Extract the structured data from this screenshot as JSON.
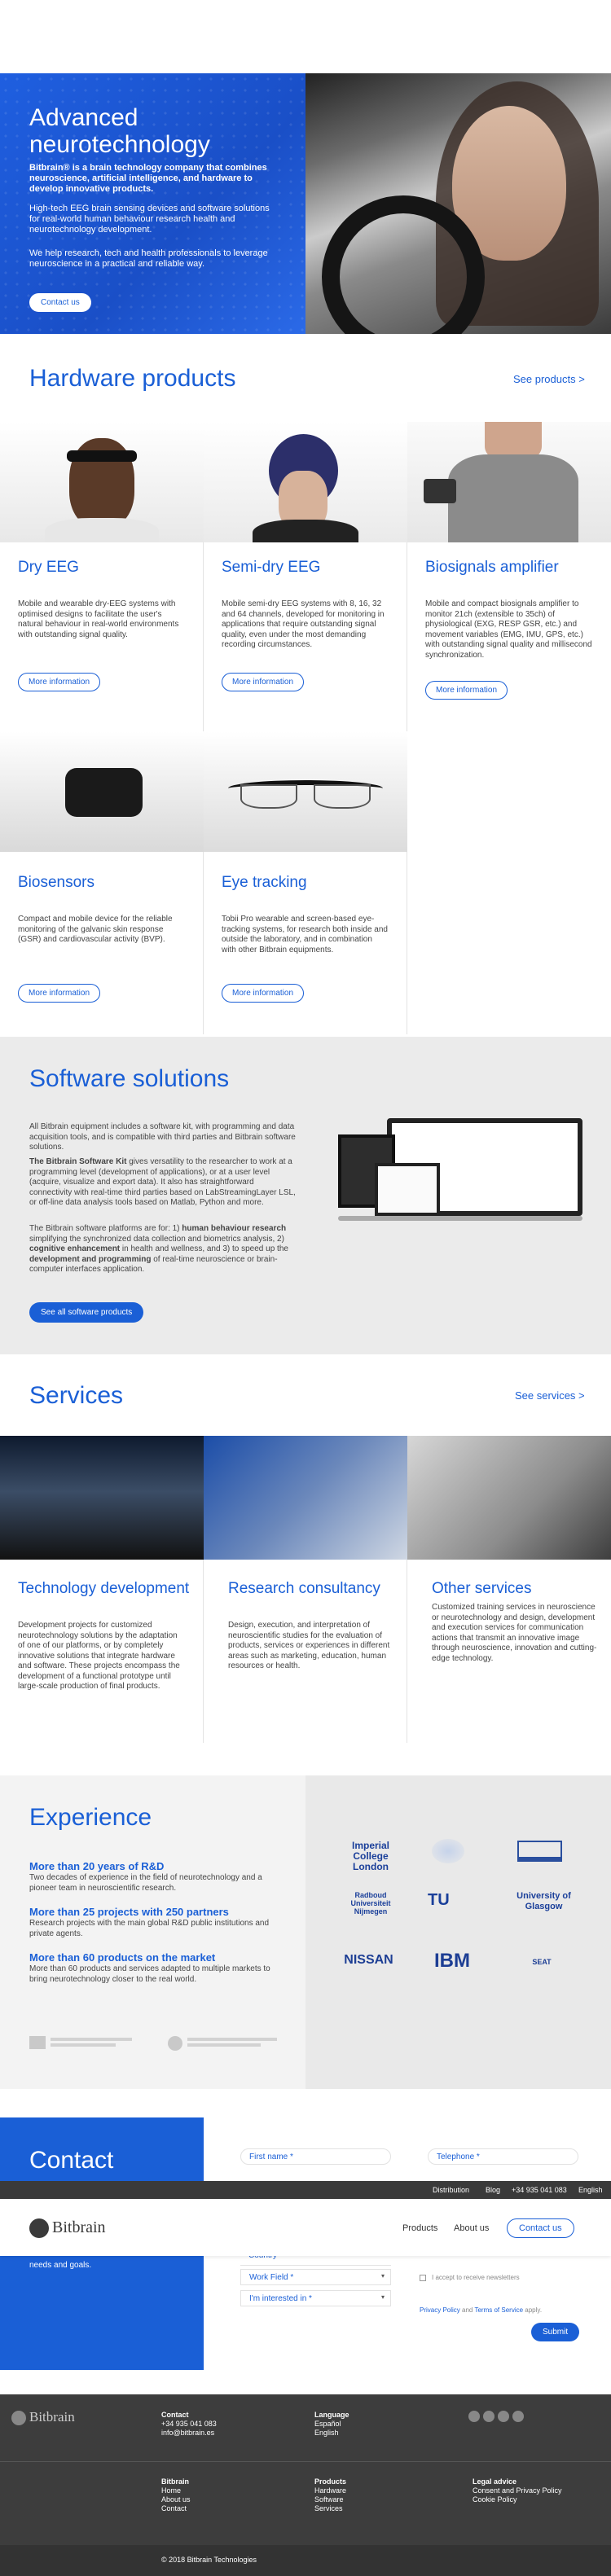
{
  "hero": {
    "title_line1": "Advanced",
    "title_line2": "neurotechnology",
    "tagline": "Bitbrain® is a brain technology company that combines neuroscience, artificial intelligence, and hardware to develop innovative products.",
    "para1": "High-tech EEG brain sensing devices and software solutions for real-world human behaviour research health and neurotechnology development.",
    "para2": "We help research, tech and health professionals to leverage neuroscience in a practical and reliable way.",
    "cta": "Contact us"
  },
  "hardware": {
    "title": "Hardware products",
    "link": "See products >",
    "products": [
      {
        "title": "Dry EEG",
        "desc": "Mobile and wearable dry-EEG systems with optimised designs to facilitate the user's natural behaviour in real-world environments with outstanding signal quality.",
        "button": "More information"
      },
      {
        "title": "Semi-dry EEG",
        "desc": "Mobile semi-dry EEG systems with 8, 16, 32 and 64 channels, developed for monitoring in applications that require outstanding signal quality, even under the most demanding recording circumstances.",
        "button": "More information"
      },
      {
        "title": "Biosignals amplifier",
        "desc": "Mobile and compact biosignals amplifier to monitor 21ch (extensible to 35ch) of physiological (EXG, RESP GSR, etc.) and movement variables (EMG, IMU, GPS, etc.) with outstanding signal quality and millisecond synchronization.",
        "button": "More information"
      },
      {
        "title": "Biosensors",
        "desc": "Compact and mobile device for the reliable monitoring of the galvanic skin response (GSR) and cardiovascular activity (BVP).",
        "button": "More information"
      },
      {
        "title": "Eye tracking",
        "desc": "Tobii Pro wearable and screen-based eye-tracking systems, for research both inside and outside the laboratory, and in combination with other Bitbrain equipments.",
        "button": "More information"
      }
    ]
  },
  "software": {
    "title": "Software solutions",
    "p1": "All Bitbrain equipment includes a software kit, with programming and data acquisition tools, and is compatible with third parties and Bitbrain software solutions.",
    "p2_bold": "The Bitbrain Software Kit",
    "p2": " gives versatility to the researcher to work at a programming level (development of applications), or at a user level (acquire, visualize and export data). It also has straightforward connectivity with real-time third parties based on LabStreamingLayer LSL, or off-line data analysis tools based on Matlab, Python and more.",
    "p3_a": "The Bitbrain software platforms are for: 1) ",
    "p3_b1": "human behaviour research",
    "p3_c": " simplifying the synchronized data collection and biometrics analysis, 2) ",
    "p3_b2": "cognitive enhancement",
    "p3_d": " in health and wellness, and 3) to speed up the ",
    "p3_b3": "development and programming",
    "p3_e": " of real-time neuroscience or brain-computer interfaces application.",
    "button": "See all software products"
  },
  "services": {
    "title": "Services",
    "link": "See services >",
    "items": [
      {
        "title": "Technology development",
        "desc": "Development projects for customized neurotechnology solutions by the adaptation of one of our platforms, or by completely innovative solutions that integrate hardware and software. These projects encompass the development of a functional prototype until large-scale production of final products."
      },
      {
        "title": "Research consultancy",
        "desc": "Design, execution, and interpretation of neuroscientific studies for the evaluation of products, services or experiences in different areas such as marketing, education, human resources or health."
      },
      {
        "title": "Other services",
        "desc": "Customized training services in neuroscience or neurotechnology and design, development and execution services for communication actions that transmit an innovative image through neuroscience, innovation and cutting-edge technology."
      }
    ]
  },
  "experience": {
    "title": "Experience",
    "items": [
      {
        "heading": "More than 20 years of R&D",
        "desc": "Two decades of experience in the field of neurotechnology and a pioneer team in neuroscientific research."
      },
      {
        "heading": "More than 25 projects with 250 partners",
        "desc": "Research projects with the main global R&D public institutions and private agents."
      },
      {
        "heading": "More than 60 products on the market",
        "desc": "More than 60 products and services adapted to multiple markets to bring neurotechnology closer to the real world."
      }
    ],
    "logos": [
      "Imperial College London",
      "Radboud Universiteit Nijmegen",
      "University of Glasgow",
      "NISSAN",
      "IBM",
      "SEAT"
    ]
  },
  "contact": {
    "title": "Contact",
    "intro_tail": "needs and goals.",
    "first_name": "First name *",
    "telephone": "Telephone *",
    "country": "Country",
    "work_field": "Work Field *",
    "interested": "I'm interested in *",
    "newsletter": "I accept to receive newsletters",
    "privacy": "Privacy Policy",
    "and": "and",
    "terms": "Terms of Service",
    "apply": "apply.",
    "submit": "Submit"
  },
  "topbar": {
    "items": [
      "Distribution",
      "Blog",
      "+34 935 041 083",
      "English"
    ]
  },
  "nav": {
    "brand": "Bitbrain",
    "items": [
      "Products",
      "About us"
    ],
    "contact": "Contact us"
  },
  "footer": {
    "brand": "Bitbrain",
    "contact_title": "Contact",
    "phone": "+34 935 041 083",
    "email": "info@bitbrain.es",
    "language_title": "Language",
    "languages": [
      "Español",
      "English"
    ],
    "col1": {
      "title": "Bitbrain",
      "items": [
        "Home",
        "About us",
        "Contact"
      ]
    },
    "col2": {
      "title": "Products",
      "items": [
        "Hardware",
        "Software",
        "Services"
      ]
    },
    "col3": {
      "title": "Legal advice",
      "items": [
        "Consent and Privacy Policy",
        "Cookie Policy"
      ]
    },
    "copyright": "© 2018 Bitbrain Technologies"
  },
  "colors": {
    "brand_blue": "#1a5fd6",
    "footer_bg": "#3d3d3d"
  }
}
